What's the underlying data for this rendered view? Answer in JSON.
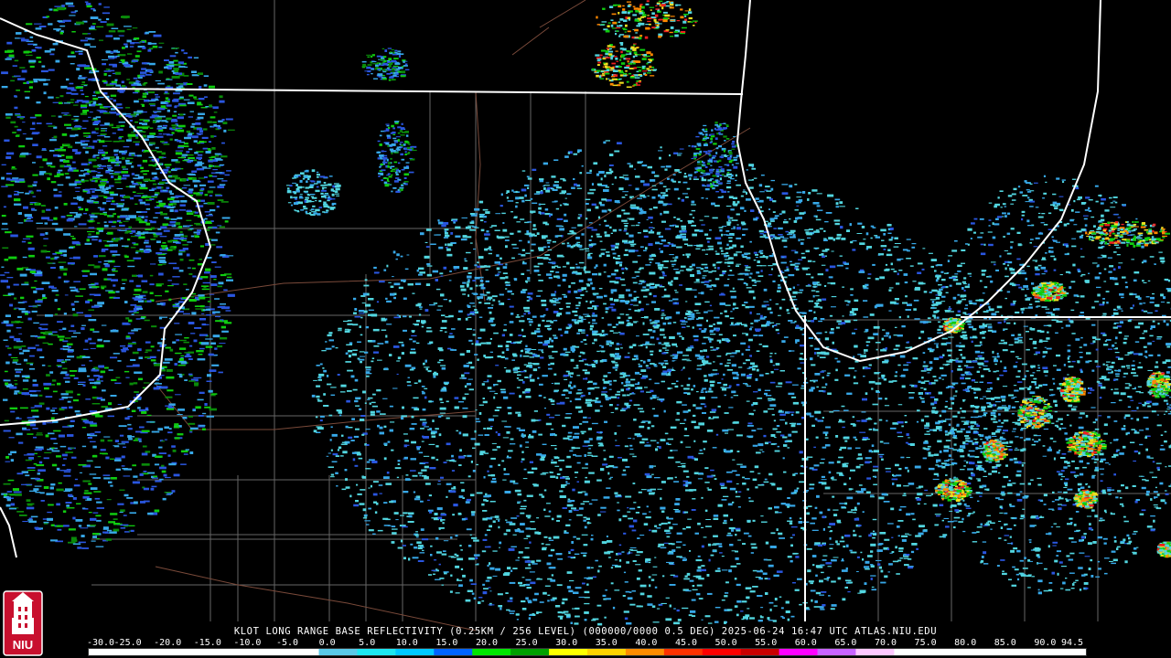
{
  "caption": "KLOT LONG RANGE BASE REFLECTIVITY (0.25KM / 256 LEVEL) (000000/0000 0.5 DEG) 2025-06-24 16:47 UTC  ATLAS.NIU.EDU",
  "logo": {
    "text": "NIU",
    "color_red": "#c8102e"
  },
  "scale": {
    "ticks": [
      "-30.0",
      "-25.0",
      "-20.0",
      "-15.0",
      "-10.0",
      "-5.0",
      "0.0",
      "5.0",
      "10.0",
      "15.0",
      "20.0",
      "25.0",
      "30.0",
      "35.0",
      "40.0",
      "45.0",
      "50.0",
      "55.0",
      "60.0",
      "65.0",
      "70.0",
      "75.0",
      "80.0",
      "85.0",
      "90.0",
      "94.5"
    ],
    "colors": [
      "#ffffff",
      "#ffffff",
      "#ffffff",
      "#ffffff",
      "#ffffff",
      "#ffffff",
      "#5ac8e6",
      "#1ee6f0",
      "#00c8ff",
      "#0064ff",
      "#00e600",
      "#00a000",
      "#ffff00",
      "#ffd200",
      "#ff8c00",
      "#ff3200",
      "#ff0000",
      "#c80000",
      "#ff00ff",
      "#c864ff",
      "#ffc8ff",
      "#ffffff",
      "#ffffff",
      "#ffffff",
      "#ffffff",
      "#ffffff"
    ]
  },
  "palette": {
    "faint": "#52d6e0",
    "light": "#37a8e8",
    "blue": "#2a56e0",
    "green": "#10cc10",
    "darkgreen": "#0a8a0a",
    "yellow": "#f0e020",
    "orange": "#ff8800",
    "red": "#ee2020",
    "state_line": "#ffffff",
    "county_line": "#707070",
    "road_line": "#7a4a3a"
  }
}
